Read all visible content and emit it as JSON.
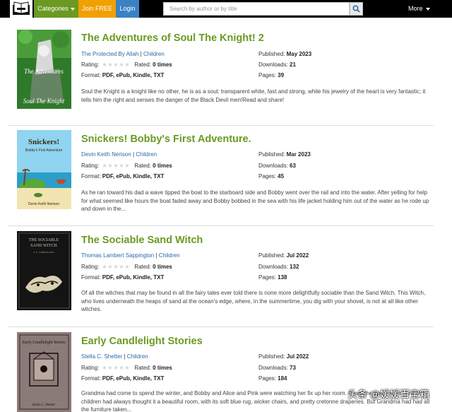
{
  "nav": {
    "categories_label": "Categories",
    "join_label": "Join FREE",
    "login_label": "Login",
    "search_placeholder": "Search by author or by title",
    "more_label": "More"
  },
  "labels": {
    "published": "Published:",
    "downloads": "Downloads:",
    "rating": "Rating:",
    "rated": "Rated:",
    "format": "Format:",
    "pages": "Pages:",
    "sep": "|"
  },
  "books": [
    {
      "title": "The Adventures of Soul The Knight! 2",
      "author": "The Protected By Allah",
      "category": "Children",
      "published": "May 2023",
      "downloads": "21",
      "rated": "0 times",
      "format": "PDF, ePub, Kindle, TXT",
      "pages": "39",
      "description": "Soul the Knight is a knight like no other, he is as a soul; transparent white, fast and strong, while his jewelry of the heart is very fantastic; it tells him the right and senses the danger of the Black Devil men!Read and share!",
      "cover_text": [
        "The Adventures",
        "Soul The Knight"
      ]
    },
    {
      "title": "Snickers! Bobby's First Adventure.",
      "author": "Devin Keith Nerison",
      "category": "Children",
      "published": "Mar 2023",
      "downloads": "63",
      "rated": "0 times",
      "format": "PDF, ePub, Kindle, TXT",
      "pages": "45",
      "description": "As he ran toward his dad a wave tipped the boat to the starboard side and Bobby went over the rail and into the water. After yelling for help for what seemed like hours the boat faded away and Bobby bobbed in the sea with his life jacket holding him out of the water as he rode up and down in the...",
      "cover_text": [
        "Snickers!",
        "Bobby's First Adventure",
        "Devin Keith Nerison"
      ]
    },
    {
      "title": "The Sociable Sand Witch",
      "author": "Thomas Lambert Sappington",
      "category": "Children",
      "published": "Jul 2022",
      "downloads": "132",
      "rated": "0 times",
      "format": "PDF, ePub, Kindle, TXT",
      "pages": "138",
      "description": "Of all the witches that may be found in all the fairy tales ever told there is none more delightfully sociable than the Sand Witch. This Witch, who lives underneath the heaps of sand at the ocean's edge, where, in the summertime, you dig with your shovel, is not at all like other witches.",
      "cover_text": [
        "THE SOCIABLE",
        "SAND WITCH",
        "T. L. SAPPINGTON"
      ]
    },
    {
      "title": "Early Candlelight Stories",
      "author": "Stella C. Shetter",
      "category": "Children",
      "published": "Jul 2022",
      "downloads": "73",
      "rated": "0 times",
      "format": "PDF, ePub, Kindle, TXT",
      "pages": "184",
      "description": "Grandma had come to spend the winter, and Bobby and Alice and Pink were watching her fix up her room. It was the spare room, and the children had always thought it a beautiful room, with its soft blue rug, wicker chairs, and pretty cretonne draperies. But Grandma had had all the furniture taken...",
      "cover_text": [
        "Early Candlelight Stories",
        "Stella C. Shetter"
      ]
    }
  ],
  "watermark": "头条 @媛媛百宝箱",
  "colors": {
    "title_green": "#6a9a22",
    "link_blue": "#2a6aa8",
    "join_orange": "#f0a000",
    "login_blue": "#3a82c4"
  }
}
